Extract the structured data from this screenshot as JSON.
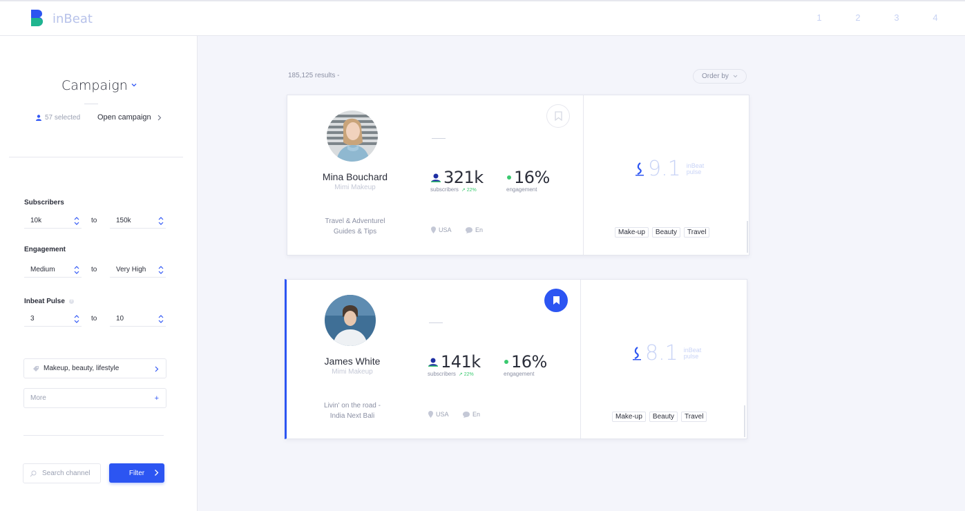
{
  "app": {
    "brand": "inBeat",
    "steps": [
      "1",
      "2",
      "3",
      "4"
    ]
  },
  "sidebar": {
    "campaign_title": "Campaign",
    "selected_count": "57 selected",
    "open_campaign": "Open campaign",
    "filters": {
      "subscribers": {
        "label": "Subscribers",
        "from": "10k",
        "to_word": "to",
        "to": "150k"
      },
      "engagement": {
        "label": "Engagement",
        "from": "Medium",
        "to_word": "to",
        "to": "Very High"
      },
      "pulse": {
        "label": "Inbeat Pulse",
        "help": "?",
        "from": "3",
        "to_word": "to",
        "to": "10"
      }
    },
    "category": "Makeup, beauty, lifestyle",
    "more": "More",
    "more_plus": "+",
    "search_placeholder": "Search channel",
    "filter_button": "Filter"
  },
  "main": {
    "results": "185,125 results  -",
    "order_by": "Order by",
    "cards": [
      {
        "name": "Mina Bouchard",
        "handle": "Mimi Makeup",
        "bio_line1": "Travel & Adventurel",
        "bio_line2": "Guides & Tips",
        "subscribers": "321k",
        "subscribers_label": "subscribers",
        "growth": "↗ 22%",
        "engagement": "16%",
        "engagement_label": "engagement",
        "country": "USA",
        "language": "En",
        "pulse": "9.1",
        "pulse_label1": "inBeat",
        "pulse_label2": "pulse",
        "tags": [
          "Make-up",
          "Beauty",
          "Travel"
        ],
        "bookmarked": false
      },
      {
        "name": "James White",
        "handle": "Mimi Makeup",
        "bio_line1": "Livin' on the road -",
        "bio_line2": "India Next Bali",
        "subscribers": "141k",
        "subscribers_label": "subscribers",
        "growth": "↗ 22%",
        "engagement": "16%",
        "engagement_label": "engagement",
        "country": "USA",
        "language": "En",
        "pulse": "8.1",
        "pulse_label1": "inBeat",
        "pulse_label2": "pulse",
        "tags": [
          "Make-up",
          "Beauty",
          "Travel"
        ],
        "bookmarked": true
      }
    ]
  },
  "colors": {
    "accent": "#2c55f2",
    "green": "#3ac96f",
    "pulse": "#c8d3f6"
  }
}
